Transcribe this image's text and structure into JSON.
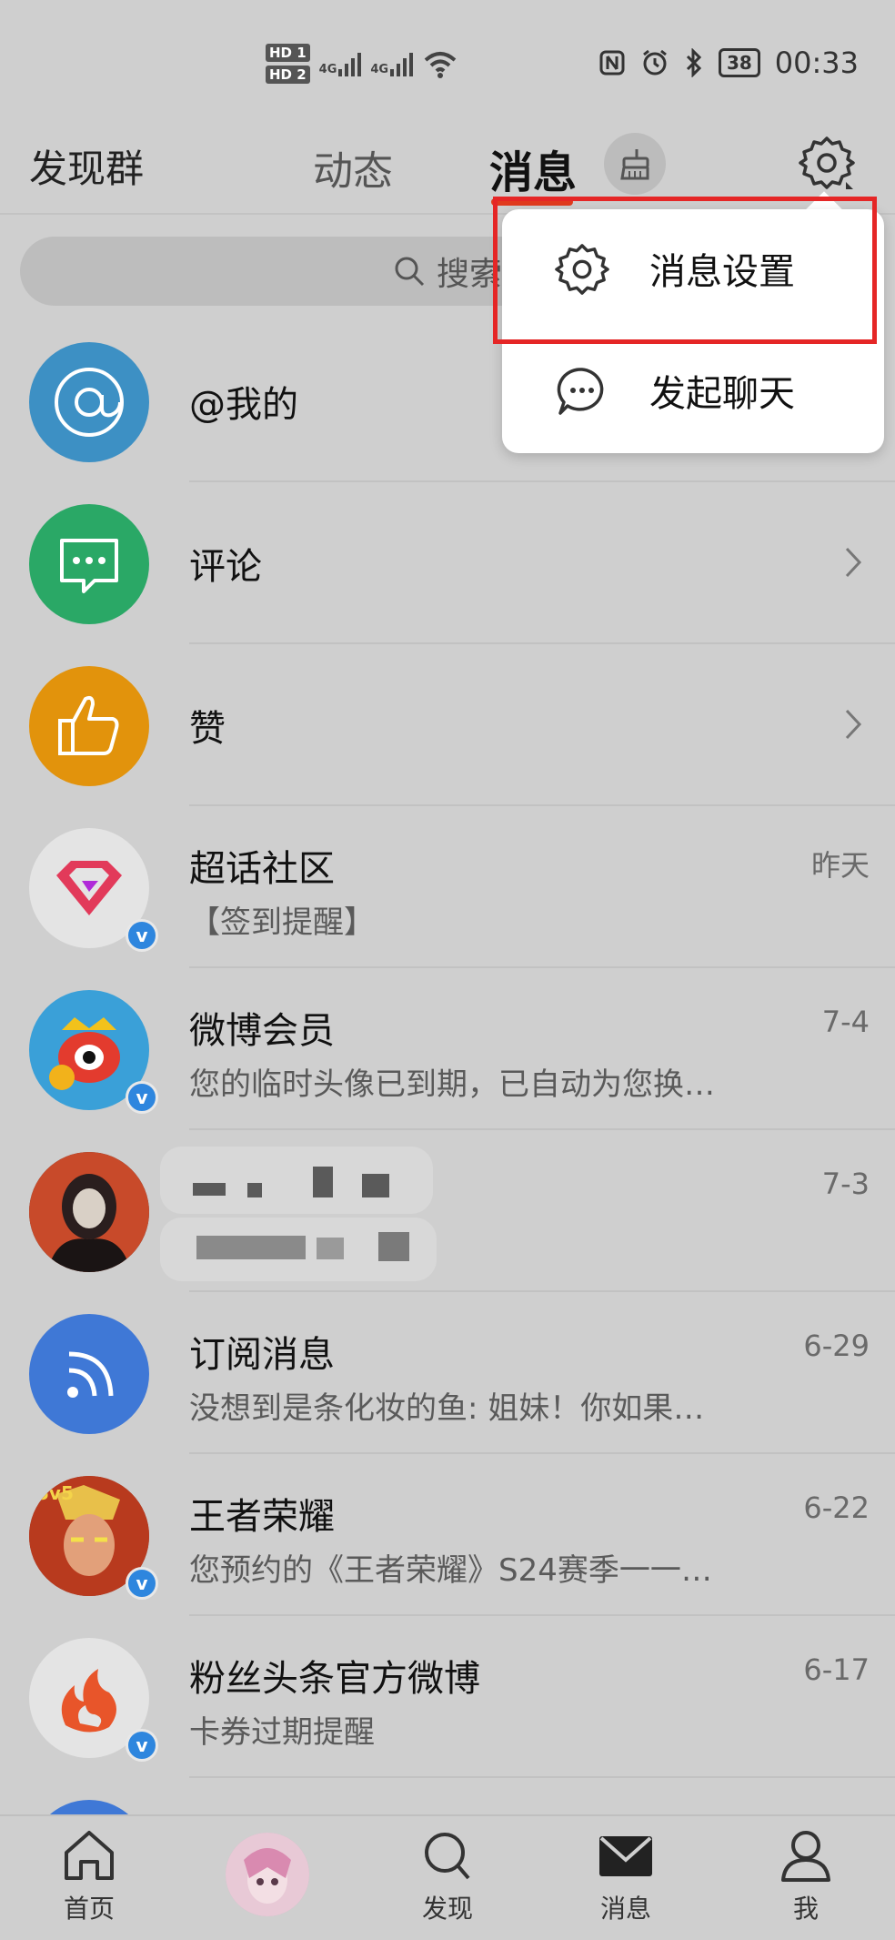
{
  "status_bar": {
    "hd1": "HD 1",
    "hd2": "HD 2",
    "network1": "4G",
    "network2": "4G",
    "battery": "38",
    "time": "00:33"
  },
  "nav": {
    "discover": "发现群",
    "feed": "动态",
    "messages": "消息"
  },
  "search": {
    "placeholder": "搜索"
  },
  "popup": {
    "items": [
      {
        "label": "消息设置"
      },
      {
        "label": "发起聊天"
      }
    ]
  },
  "rows": [
    {
      "title": "@我的"
    },
    {
      "title": "评论"
    },
    {
      "title": "赞"
    },
    {
      "title": "超话社区",
      "subtitle": "【签到提醒】",
      "date": "昨天"
    },
    {
      "title": "微博会员",
      "subtitle": "您的临时头像已到期，已自动为您换…",
      "date": "7-4"
    },
    {
      "title": "",
      "subtitle": "",
      "date": "7-3"
    },
    {
      "title": "订阅消息",
      "subtitle": "没想到是条化妆的鱼: 姐妹！你如果…",
      "date": "6-29"
    },
    {
      "title": "王者荣耀",
      "subtitle": "您预约的《王者荣耀》S24赛季一一…",
      "date": "6-22"
    },
    {
      "title": "粉丝头条官方微博",
      "subtitle": "卡券过期提醒",
      "date": "6-17"
    }
  ],
  "tabbar": {
    "home": "首页",
    "discover": "发现",
    "messages": "消息",
    "me": "我"
  },
  "colors": {
    "accent": "#e13a1e",
    "highlight_box": "#e52626",
    "mention": "#3d90c4",
    "comment": "#2aa866",
    "like": "#e2930c",
    "subscribe": "#3f78d6",
    "verified": "#2e86de"
  }
}
